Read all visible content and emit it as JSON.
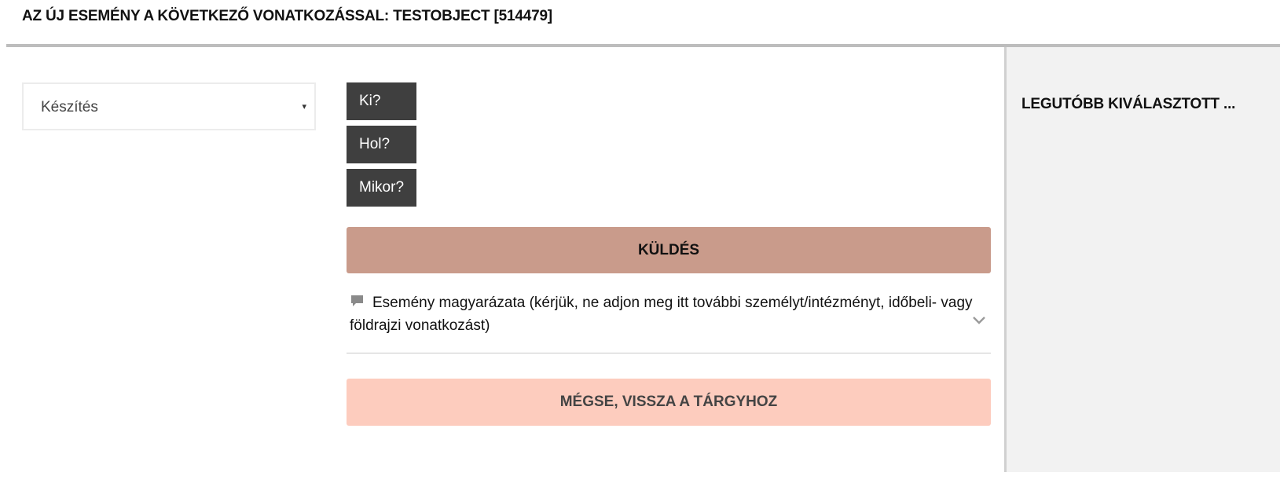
{
  "header": {
    "title": "AZ ÚJ ESEMÉNY A KÖVETKEZŐ VONATKOZÁSSAL: TESTOBJECT [514479]"
  },
  "event_type_select": {
    "value": "Készítés",
    "caret": "▾"
  },
  "questions": [
    {
      "label": "Ki?"
    },
    {
      "label": "Hol?"
    },
    {
      "label": "Mikor?"
    }
  ],
  "send_button": {
    "label": "KÜLDÉS"
  },
  "explanation": {
    "icon": "comment-icon",
    "text": "Esemény magyarázata (kérjük, ne adjon meg itt további személyt/intézményt, időbeli- vagy földrajzi vonatkozást)",
    "expand_icon": "chevron-down-icon"
  },
  "cancel_button": {
    "label": "MÉGSE, VISSZA A TÁRGYHOZ"
  },
  "sidebar": {
    "title": "LEGUTÓBB KIVÁLASZTOTT ..."
  },
  "colors": {
    "question_button_bg": "#3f3f3f",
    "send_button_bg": "#c99b8b",
    "cancel_button_bg": "#fdccbe",
    "sidebar_bg": "#f2f2f2"
  }
}
